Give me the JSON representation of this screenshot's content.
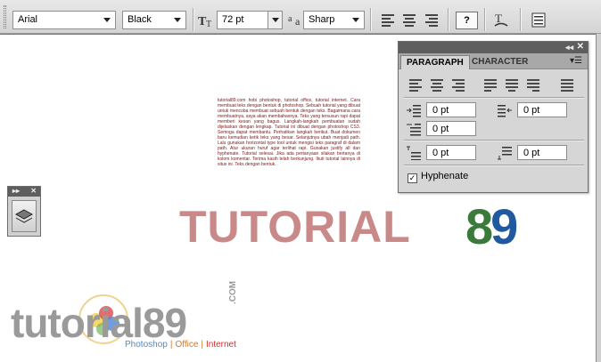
{
  "toolbar": {
    "font_family": "Arial",
    "font_style": "Black",
    "font_size": "72 pt",
    "antialias": "Sharp",
    "help_label": "?",
    "icons": [
      "text-size-icon",
      "antialias-icon",
      "align-left-icon",
      "align-center-icon",
      "align-right-icon",
      "help-icon",
      "warp-text-icon",
      "palettes-icon"
    ]
  },
  "paragraph_panel": {
    "tabs": [
      {
        "label": "PARAGRAPH",
        "active": true
      },
      {
        "label": "CHARACTER",
        "active": false
      }
    ],
    "indent_left": "0 pt",
    "indent_right": "0 pt",
    "indent_first": "0 pt",
    "space_before": "0 pt",
    "space_after": "0 pt",
    "hyphenate_label": "Hyphenate",
    "hyphenate_checked": true
  },
  "canvas": {
    "paragraph_text": "tutorial89.com hobi photoshop, tutorial office, tutorial internet. Cara membuat teks dengan bentuk di photoshop. Sebuah tutorial yang dibuat untuk mencoba membuat sebuah bentuk dengan teks. Bagaimana cara membuatnya, saya akan membahasnya. Teks yang tersusun rapi dapat memberi kesan yang bagus. Langkah-langkah pembuatan sudah dijelaskan dengan lengkap. Tutorial ini dibuat dengan photoshop CS3. Semoga dapat membantu. Perhatikan langkah berikut. Buat dokumen baru kemudian ketik teks yang besar. Selanjutnya ubah menjadi path. Lalu gunakan horizontal type tool untuk mengisi teks paragraf di dalam path. Atur ukuran huruf agar terlihat rapi. Gunakan justify all dan hyphenate. Tutorial selesai. Jika ada pertanyaan silakan bertanya di kolom komentar. Terima kasih telah berkunjung. Ikuti tutorial lainnya di situs ini. Teks dengan bentuk.",
    "big_text": "TUTORIAL",
    "big_num_8": "8",
    "big_num_9": "9",
    "num8_color": "#3a7a3a",
    "num9_color": "#1f5aa0"
  },
  "logo": {
    "text": "tutorial89",
    "dotcom": ".COM",
    "tag_photoshop": "Photoshop",
    "tag_office": "Office",
    "tag_internet": "Internet",
    "separator": "|"
  }
}
